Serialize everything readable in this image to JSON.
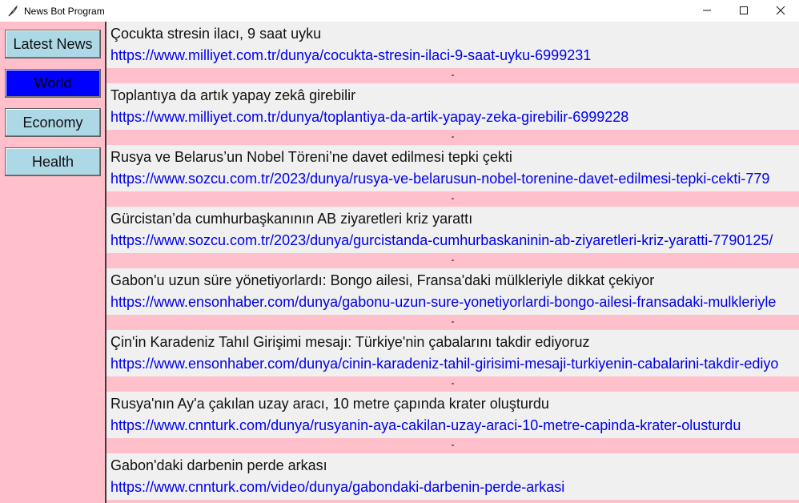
{
  "window": {
    "title": "News Bot Program"
  },
  "sidebar": {
    "buttons": [
      {
        "label": "Latest News"
      },
      {
        "label": "World"
      },
      {
        "label": "Economy"
      },
      {
        "label": "Health"
      }
    ],
    "active": "World"
  },
  "colors": {
    "background": "#ffc0cb",
    "button": "#add8e6",
    "active_button": "#0000ff",
    "link": "#0000ee",
    "row_bg": "#f0f0f0"
  },
  "news": [
    {
      "title": "Çocukta stresin ilacı, 9 saat uyku",
      "url": "https://www.milliyet.com.tr/dunya/cocukta-stresin-ilaci-9-saat-uyku-6999231",
      "separator": "-"
    },
    {
      "title": "Toplantıya da artık yapay zekâ girebilir",
      "url": "https://www.milliyet.com.tr/dunya/toplantiya-da-artik-yapay-zeka-girebilir-6999228",
      "separator": "-"
    },
    {
      "title": "Rusya ve Belarus’un Nobel Töreni’ne davet edilmesi tepki çekti",
      "url": "https://www.sozcu.com.tr/2023/dunya/rusya-ve-belarusun-nobel-torenine-davet-edilmesi-tepki-cekti-779",
      "separator": "-"
    },
    {
      "title": "Gürcistan’da cumhurbaşkanının AB ziyaretleri kriz yarattı",
      "url": "https://www.sozcu.com.tr/2023/dunya/gurcistanda-cumhurbaskaninin-ab-ziyaretleri-kriz-yaratti-7790125/",
      "separator": "-"
    },
    {
      "title": "Gabon'u uzun süre yönetiyorlardı: Bongo ailesi, Fransa'daki mülkleriyle dikkat çekiyor",
      "url": "https://www.ensonhaber.com/dunya/gabonu-uzun-sure-yonetiyorlardi-bongo-ailesi-fransadaki-mulkleriyle",
      "separator": "-"
    },
    {
      "title": "Çin'in Karadeniz Tahıl Girişimi mesajı: Türkiye'nin çabalarını takdir ediyoruz",
      "url": "https://www.ensonhaber.com/dunya/cinin-karadeniz-tahil-girisimi-mesaji-turkiyenin-cabalarini-takdir-ediyo",
      "separator": "-"
    },
    {
      "title": "Rusya'nın Ay'a çakılan uzay aracı, 10 metre çapında krater oluşturdu",
      "url": "https://www.cnnturk.com/dunya/rusyanin-aya-cakilan-uzay-araci-10-metre-capinda-krater-olusturdu",
      "separator": "-"
    },
    {
      "title": "Gabon'daki darbenin perde arkası",
      "url": "https://www.cnnturk.com/video/dunya/gabondaki-darbenin-perde-arkasi",
      "separator": "-"
    }
  ]
}
